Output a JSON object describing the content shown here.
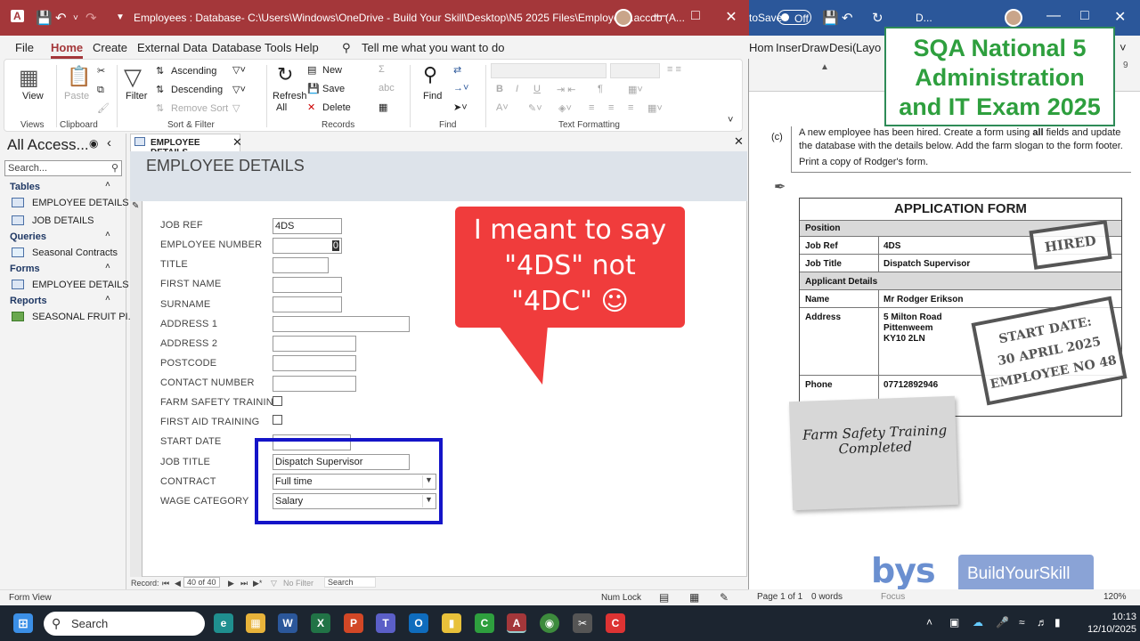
{
  "access": {
    "title": "Employees : Database- C:\\Users\\Windows\\OneDrive - Build Your Skill\\Desktop\\N5 2025 Files\\Employees.accdb (A...",
    "menu": [
      "File",
      "Home",
      "Create",
      "External Data",
      "Database Tools",
      "Help"
    ],
    "tell_me": "Tell me what you want to do",
    "ribbon": {
      "view": "View",
      "paste": "Paste",
      "filter": "Filter",
      "ascending": "Ascending",
      "descending": "Descending",
      "remove_sort": "Remove Sort",
      "refresh": "Refresh",
      "refresh_all": "All",
      "new": "New",
      "save": "Save",
      "delete": "Delete",
      "find": "Find",
      "groups": {
        "views": "Views",
        "clipboard": "Clipboard",
        "sort_filter": "Sort & Filter",
        "records": "Records",
        "find": "Find",
        "text_formatting": "Text Formatting"
      }
    },
    "nav": {
      "header": "All Access...",
      "search_placeholder": "Search...",
      "sections": [
        {
          "name": "Tables",
          "items": [
            "EMPLOYEE DETAILS",
            "JOB DETAILS"
          ]
        },
        {
          "name": "Queries",
          "items": [
            "Seasonal Contracts"
          ]
        },
        {
          "name": "Forms",
          "items": [
            "EMPLOYEE DETAILS"
          ]
        },
        {
          "name": "Reports",
          "items": [
            "SEASONAL FRUIT PI..."
          ]
        }
      ]
    },
    "form": {
      "tab": "EMPLOYEE DETAILS",
      "heading": "EMPLOYEE DETAILS",
      "fields": [
        {
          "label": "JOB REF",
          "value": "4DS"
        },
        {
          "label": "EMPLOYEE NUMBER",
          "value": "0"
        },
        {
          "label": "TITLE",
          "value": ""
        },
        {
          "label": "FIRST NAME",
          "value": ""
        },
        {
          "label": "SURNAME",
          "value": ""
        },
        {
          "label": "ADDRESS 1",
          "value": ""
        },
        {
          "label": "ADDRESS 2",
          "value": ""
        },
        {
          "label": "POSTCODE",
          "value": ""
        },
        {
          "label": "CONTACT NUMBER",
          "value": ""
        },
        {
          "label": "FARM SAFETY TRAINING",
          "value": ""
        },
        {
          "label": "FIRST AID TRAINING",
          "value": ""
        },
        {
          "label": "START DATE",
          "value": ""
        },
        {
          "label": "JOB TITLE",
          "value": "Dispatch Supervisor"
        },
        {
          "label": "CONTRACT",
          "value": "Full time"
        },
        {
          "label": "WAGE CATEGORY",
          "value": "Salary"
        }
      ],
      "callout": [
        "I meant to say",
        "\"4DS\" not",
        "\"4DC\" ☺"
      ]
    },
    "record_nav": {
      "label": "Record:",
      "position": "40 of 40",
      "filter": "No Filter",
      "search": "Search"
    },
    "status": {
      "left": "Form View",
      "num_lock": "Num Lock"
    }
  },
  "word": {
    "autosave": "toSave",
    "toggle": "Off",
    "doc": "D...",
    "menu": [
      "Hom",
      "Inser",
      "Draw",
      "Desi(",
      "Layo"
    ],
    "banner": [
      "SQA National 5",
      "Administration",
      "and IT Exam 2025"
    ],
    "question_label": "(c)",
    "question": [
      "A new employee has been hired. Create a form using ",
      "all",
      " fields and update the database with the details below. Add the farm slogan to the form footer."
    ],
    "print_line": "Print a copy of Rodger's form.",
    "application_form": {
      "title": "APPLICATION FORM",
      "position_header": "Position",
      "job_ref_label": "Job Ref",
      "job_ref": "4DS",
      "job_title_label": "Job Title",
      "job_title": "Dispatch Supervisor",
      "applicant_header": "Applicant Details",
      "name_label": "Name",
      "name": "Mr Rodger Erikson",
      "address_label": "Address",
      "address": [
        "5 Milton Road",
        "Pittenweem",
        "KY10 2LN"
      ],
      "phone_label": "Phone",
      "phone": "07712892946"
    },
    "stamps": {
      "hired": "HIRED",
      "start": [
        "START DATE:",
        "30 APRIL 2025",
        "EMPLOYEE NO 48"
      ]
    },
    "note": "Farm Safety Training Completed",
    "brand": [
      "bys",
      "BuildYourSkill"
    ],
    "status": {
      "page": "Page 1 of 1",
      "words": "0 words",
      "focus": "Focus",
      "zoom": "120%"
    }
  },
  "taskbar": {
    "search": "Search",
    "time": "10:13",
    "date": "12/10/2025"
  }
}
